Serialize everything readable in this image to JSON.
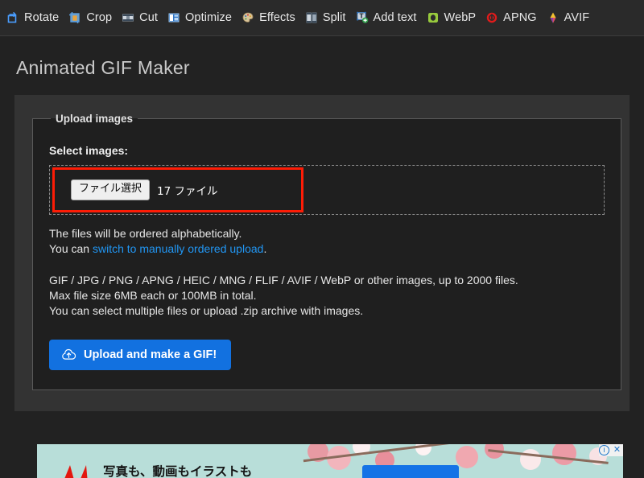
{
  "toolbar": {
    "items": [
      {
        "label": "Rotate",
        "icon": "rotate-icon"
      },
      {
        "label": "Crop",
        "icon": "crop-icon"
      },
      {
        "label": "Cut",
        "icon": "cut-icon"
      },
      {
        "label": "Optimize",
        "icon": "optimize-icon"
      },
      {
        "label": "Effects",
        "icon": "effects-icon"
      },
      {
        "label": "Split",
        "icon": "split-icon"
      },
      {
        "label": "Add text",
        "icon": "add-text-icon"
      },
      {
        "label": "WebP",
        "icon": "webp-icon"
      },
      {
        "label": "APNG",
        "icon": "apng-icon"
      },
      {
        "label": "AVIF",
        "icon": "avif-icon"
      }
    ]
  },
  "page": {
    "title": "Animated GIF Maker"
  },
  "upload": {
    "legend": "Upload images",
    "select_label": "Select images:",
    "file_button_label": "ファイル選択",
    "file_count_text": "17 ファイル",
    "notes": {
      "order_line": "The files will be ordered alphabetically.",
      "switch_prefix": "You can ",
      "switch_link": "switch to manually ordered upload",
      "switch_suffix": ".",
      "formats_line": "GIF / JPG / PNG / APNG / HEIC / MNG / FLIF / AVIF / WebP or other images, up to 2000 files.",
      "size_line": "Max file size 6MB each or 100MB in total.",
      "multiple_line": "You can select multiple files or upload .zip archive with images."
    },
    "submit_label": "Upload and make a GIF!",
    "submit_icon": "cloud-upload-icon"
  },
  "ad": {
    "headline": "写真も、動画もイラストも",
    "info_label": "i",
    "close_label": "✕"
  },
  "colors": {
    "accent_blue": "#1271e0",
    "link_blue": "#2196f3",
    "highlight_red": "#fd1c06",
    "page_bg": "#222222",
    "card_bg": "#333333",
    "fieldset_bg": "#1f1f1f",
    "toolbar_bg": "#2a2a2a"
  }
}
